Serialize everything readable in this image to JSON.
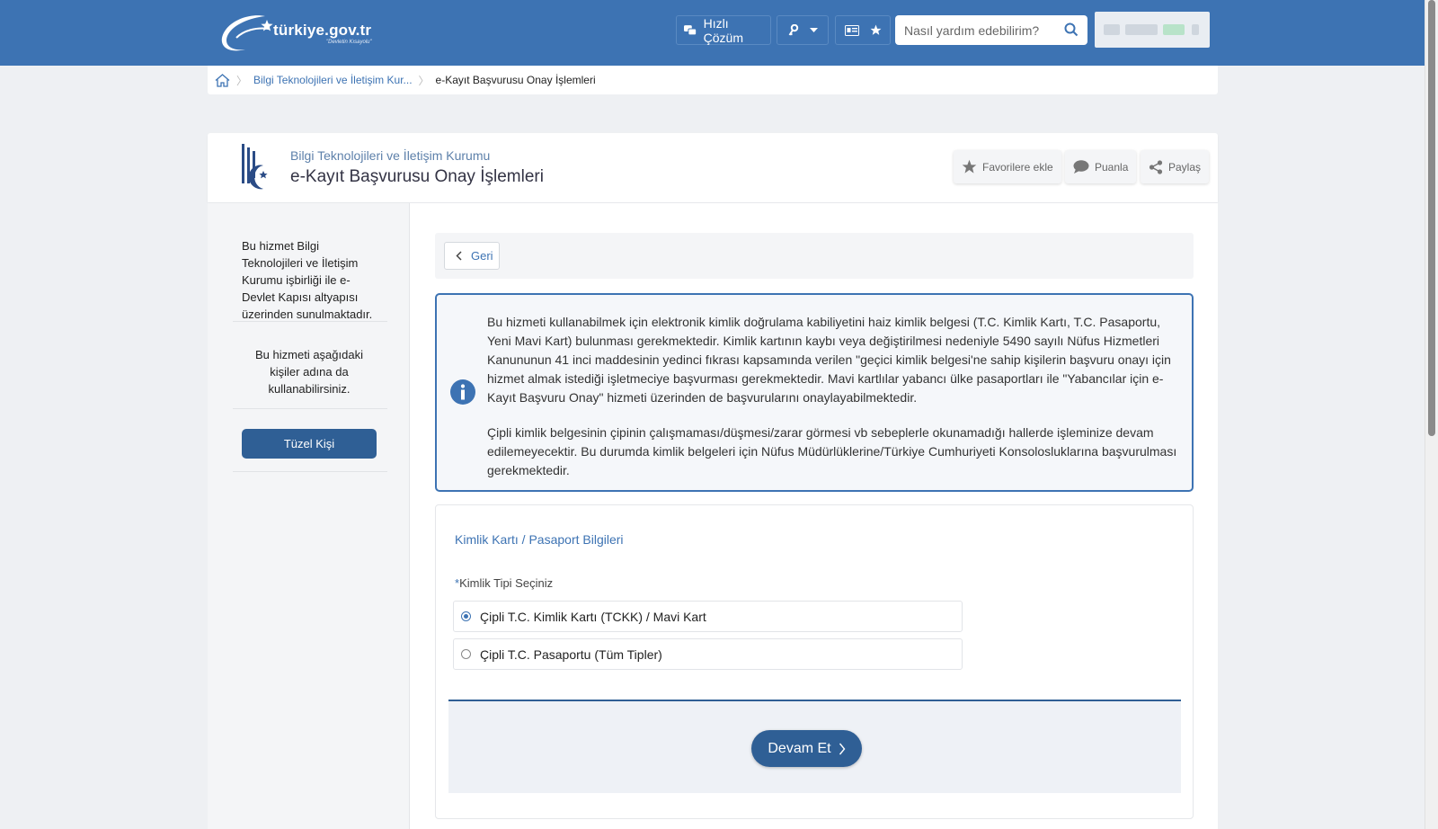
{
  "header": {
    "logo_text": "türkiye.gov.tr",
    "logo_subtext": "\"Devletin Kısayolu\"",
    "quick_solution_label": "Hızlı Çözüm",
    "search_placeholder": "Nasıl yardım edebilirim?"
  },
  "breadcrumb": {
    "items": [
      "Bilgi Teknolojileri ve İletişim Kur...",
      "e-Kayıt Başvurusu Onay İşlemleri"
    ]
  },
  "service": {
    "institution": "Bilgi Teknolojileri ve İletişim Kurumu",
    "title": "e-Kayıt Başvurusu Onay İşlemleri",
    "actions": {
      "favorite": "Favorilere ekle",
      "rate": "Puanla",
      "share": "Paylaş"
    }
  },
  "sidebar": {
    "info_text": "Bu hizmet Bilgi Teknolojileri ve İletişim Kurumu işbirliği ile e-Devlet Kapısı altyapısı üzerinden sunulmaktadır.",
    "on_behalf_text": "Bu hizmeti aşağıdaki kişiler adına da kullanabilirsiniz.",
    "legal_entity_button": "Tüzel Kişi"
  },
  "main": {
    "back_label": "Geri",
    "info_paragraph_1": "Bu hizmeti kullanabilmek için elektronik kimlik doğrulama kabiliyetini haiz kimlik belgesi (T.C. Kimlik Kartı, T.C. Pasaportu, Yeni Mavi Kart) bulunması gerekmektedir. Kimlik kartının kaybı veya değiştirilmesi nedeniyle 5490 sayılı Nüfus Hizmetleri Kanununun 41 inci maddesinin yedinci fıkrası kapsamında verilen \"geçici kimlik belgesi'ne sahip kişilerin başvuru onayı için hizmet almak istediği işletmeciye başvurması gerekmektedir. Mavi kartlılar yabancı ülke pasaportları ile \"Yabancılar için e-Kayıt Başvuru Onay\" hizmeti üzerinden de başvurularını onaylayabilmektedir.",
    "info_paragraph_2": "Çipli kimlik belgesinin çipinin çalışmaması/düşmesi/zarar görmesi vb sebeplerle okunamadığı hallerde işleminize devam edilemeyecektir. Bu durumda kimlik belgeleri için Nüfus Müdürlüklerine/Türkiye Cumhuriyeti Konsolosluklarına başvurulması gerekmektedir.",
    "form_title": "Kimlik Kartı / Pasaport Bilgileri",
    "field_required_mark": "*",
    "field_label": "Kimlik Tipi Seçiniz",
    "options": [
      {
        "label": "Çipli T.C. Kimlik Kartı (TCKK) / Mavi Kart",
        "selected": true
      },
      {
        "label": "Çipli T.C. Pasaportu (Tüm Tipler)",
        "selected": false
      }
    ],
    "continue_label": "Devam Et"
  },
  "colors": {
    "brand_blue": "#3d73b3",
    "button_dark_blue": "#2f5f95"
  }
}
